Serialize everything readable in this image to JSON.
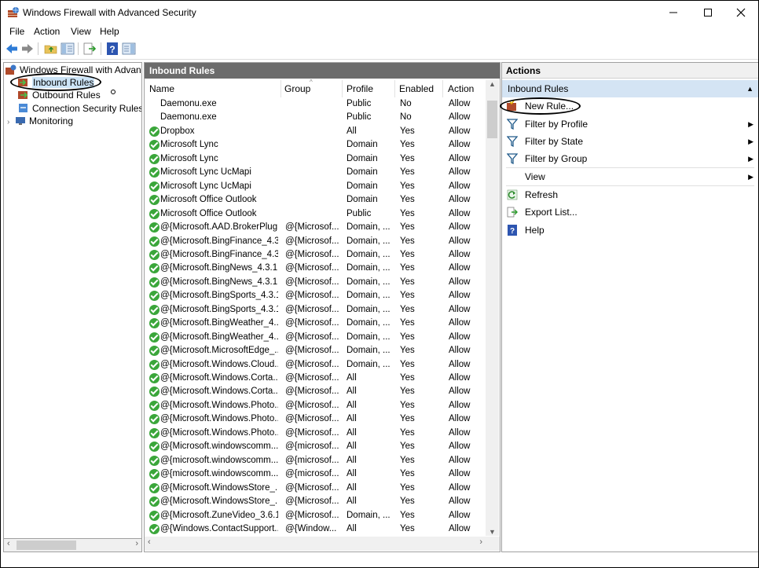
{
  "window": {
    "title": "Windows Firewall with Advanced Security"
  },
  "menu": {
    "file": "File",
    "action": "Action",
    "view": "View",
    "help": "Help"
  },
  "tree": {
    "root": "Windows Firewall with Advance",
    "items": [
      "Inbound Rules",
      "Outbound Rules",
      "Connection Security Rules",
      "Monitoring"
    ]
  },
  "center": {
    "header": "Inbound Rules",
    "columns": {
      "name": "Name",
      "group": "Group",
      "profile": "Profile",
      "enabled": "Enabled",
      "action": "Action"
    },
    "rows": [
      {
        "icon": "none",
        "name": "Daemonu.exe",
        "group": "",
        "profile": "Public",
        "enabled": "No",
        "action": "Allow"
      },
      {
        "icon": "none",
        "name": "Daemonu.exe",
        "group": "",
        "profile": "Public",
        "enabled": "No",
        "action": "Allow"
      },
      {
        "icon": "check",
        "name": "Dropbox",
        "group": "",
        "profile": "All",
        "enabled": "Yes",
        "action": "Allow"
      },
      {
        "icon": "check",
        "name": "Microsoft Lync",
        "group": "",
        "profile": "Domain",
        "enabled": "Yes",
        "action": "Allow"
      },
      {
        "icon": "check",
        "name": "Microsoft Lync",
        "group": "",
        "profile": "Domain",
        "enabled": "Yes",
        "action": "Allow"
      },
      {
        "icon": "check",
        "name": "Microsoft Lync UcMapi",
        "group": "",
        "profile": "Domain",
        "enabled": "Yes",
        "action": "Allow"
      },
      {
        "icon": "check",
        "name": "Microsoft Lync UcMapi",
        "group": "",
        "profile": "Domain",
        "enabled": "Yes",
        "action": "Allow"
      },
      {
        "icon": "check",
        "name": "Microsoft Office Outlook",
        "group": "",
        "profile": "Domain",
        "enabled": "Yes",
        "action": "Allow"
      },
      {
        "icon": "check",
        "name": "Microsoft Office Outlook",
        "group": "",
        "profile": "Public",
        "enabled": "Yes",
        "action": "Allow"
      },
      {
        "icon": "check",
        "name": "@{Microsoft.AAD.BrokerPlug...",
        "group": "@{Microsof...",
        "profile": "Domain, ...",
        "enabled": "Yes",
        "action": "Allow"
      },
      {
        "icon": "check",
        "name": "@{Microsoft.BingFinance_4.3...",
        "group": "@{Microsof...",
        "profile": "Domain, ...",
        "enabled": "Yes",
        "action": "Allow"
      },
      {
        "icon": "check",
        "name": "@{Microsoft.BingFinance_4.3...",
        "group": "@{Microsof...",
        "profile": "Domain, ...",
        "enabled": "Yes",
        "action": "Allow"
      },
      {
        "icon": "check",
        "name": "@{Microsoft.BingNews_4.3.1...",
        "group": "@{Microsof...",
        "profile": "Domain, ...",
        "enabled": "Yes",
        "action": "Allow"
      },
      {
        "icon": "check",
        "name": "@{Microsoft.BingNews_4.3.1...",
        "group": "@{Microsof...",
        "profile": "Domain, ...",
        "enabled": "Yes",
        "action": "Allow"
      },
      {
        "icon": "check",
        "name": "@{Microsoft.BingSports_4.3.1...",
        "group": "@{Microsof...",
        "profile": "Domain, ...",
        "enabled": "Yes",
        "action": "Allow"
      },
      {
        "icon": "check",
        "name": "@{Microsoft.BingSports_4.3.1...",
        "group": "@{Microsof...",
        "profile": "Domain, ...",
        "enabled": "Yes",
        "action": "Allow"
      },
      {
        "icon": "check",
        "name": "@{Microsoft.BingWeather_4....",
        "group": "@{Microsof...",
        "profile": "Domain, ...",
        "enabled": "Yes",
        "action": "Allow"
      },
      {
        "icon": "check",
        "name": "@{Microsoft.BingWeather_4....",
        "group": "@{Microsof...",
        "profile": "Domain, ...",
        "enabled": "Yes",
        "action": "Allow"
      },
      {
        "icon": "check",
        "name": "@{Microsoft.MicrosoftEdge_...",
        "group": "@{Microsof...",
        "profile": "Domain, ...",
        "enabled": "Yes",
        "action": "Allow"
      },
      {
        "icon": "check",
        "name": "@{Microsoft.Windows.Cloud...",
        "group": "@{Microsof...",
        "profile": "Domain, ...",
        "enabled": "Yes",
        "action": "Allow"
      },
      {
        "icon": "check",
        "name": "@{Microsoft.Windows.Corta...",
        "group": "@{Microsof...",
        "profile": "All",
        "enabled": "Yes",
        "action": "Allow"
      },
      {
        "icon": "check",
        "name": "@{Microsoft.Windows.Corta...",
        "group": "@{Microsof...",
        "profile": "All",
        "enabled": "Yes",
        "action": "Allow"
      },
      {
        "icon": "check",
        "name": "@{Microsoft.Windows.Photo...",
        "group": "@{Microsof...",
        "profile": "All",
        "enabled": "Yes",
        "action": "Allow"
      },
      {
        "icon": "check",
        "name": "@{Microsoft.Windows.Photo...",
        "group": "@{Microsof...",
        "profile": "All",
        "enabled": "Yes",
        "action": "Allow"
      },
      {
        "icon": "check",
        "name": "@{Microsoft.Windows.Photo...",
        "group": "@{Microsof...",
        "profile": "All",
        "enabled": "Yes",
        "action": "Allow"
      },
      {
        "icon": "check",
        "name": "@{Microsoft.windowscomm...",
        "group": "@{microsof...",
        "profile": "All",
        "enabled": "Yes",
        "action": "Allow"
      },
      {
        "icon": "check",
        "name": "@{microsoft.windowscomm...",
        "group": "@{microsof...",
        "profile": "All",
        "enabled": "Yes",
        "action": "Allow"
      },
      {
        "icon": "check",
        "name": "@{microsoft.windowscomm...",
        "group": "@{microsof...",
        "profile": "All",
        "enabled": "Yes",
        "action": "Allow"
      },
      {
        "icon": "check",
        "name": "@{Microsoft.WindowsStore_...",
        "group": "@{Microsof...",
        "profile": "All",
        "enabled": "Yes",
        "action": "Allow"
      },
      {
        "icon": "check",
        "name": "@{Microsoft.WindowsStore_...",
        "group": "@{Microsof...",
        "profile": "All",
        "enabled": "Yes",
        "action": "Allow"
      },
      {
        "icon": "check",
        "name": "@{Microsoft.ZuneVideo_3.6.1...",
        "group": "@{Microsof...",
        "profile": "Domain, ...",
        "enabled": "Yes",
        "action": "Allow"
      },
      {
        "icon": "check",
        "name": "@{Windows.ContactSupport...",
        "group": "@{Window...",
        "profile": "All",
        "enabled": "Yes",
        "action": "Allow"
      }
    ]
  },
  "actions": {
    "header": "Actions",
    "section": "Inbound Rules",
    "items": [
      {
        "label": "New Rule...",
        "icon": "new-rule-icon",
        "submenu": false
      },
      {
        "label": "Filter by Profile",
        "icon": "filter-icon",
        "submenu": true
      },
      {
        "label": "Filter by State",
        "icon": "filter-icon",
        "submenu": true
      },
      {
        "label": "Filter by Group",
        "icon": "filter-icon",
        "submenu": true
      },
      {
        "label": "View",
        "icon": "none",
        "submenu": true
      },
      {
        "label": "Refresh",
        "icon": "refresh-icon",
        "submenu": false
      },
      {
        "label": "Export List...",
        "icon": "export-icon",
        "submenu": false
      },
      {
        "label": "Help",
        "icon": "help-icon",
        "submenu": false
      }
    ]
  },
  "colors": {
    "header_gray": "#6c6c6c",
    "action_section_blue": "#d4e4f4",
    "check_green": "#3aa63a"
  }
}
